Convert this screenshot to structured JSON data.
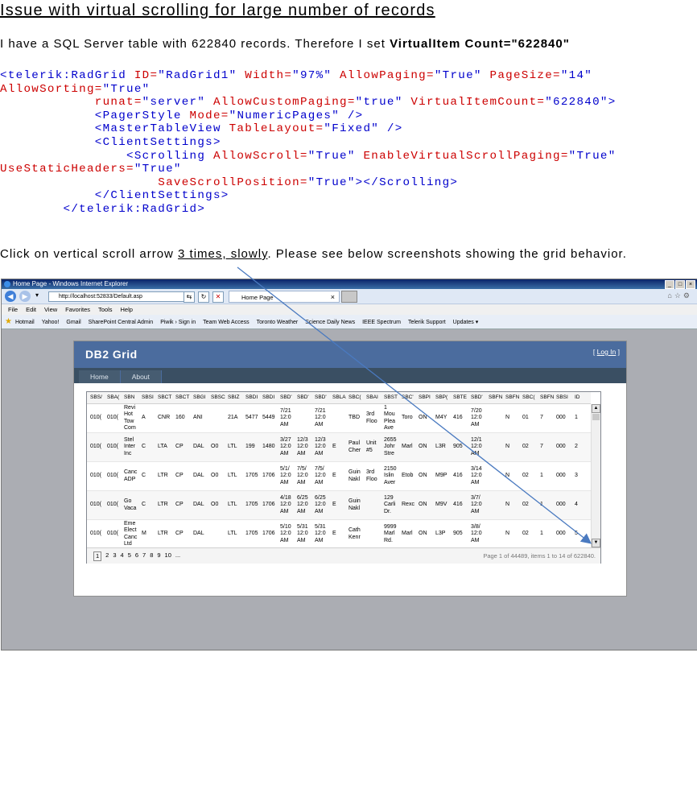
{
  "title": "Issue with virtual scrolling for large number of records",
  "intro": {
    "prefix": "I have a SQL Server table with 622840 records. Therefore I set ",
    "bold": "VirtualItem Count=\"622840\""
  },
  "code_lines": [
    [
      [
        "tag",
        "<telerik:RadGrid "
      ],
      [
        "attr",
        "ID="
      ],
      [
        "val",
        "\"RadGrid1\" "
      ],
      [
        "attr",
        "Width="
      ],
      [
        "val",
        "\"97%\" "
      ],
      [
        "attr",
        "AllowPaging="
      ],
      [
        "val",
        "\"True\" "
      ],
      [
        "attr",
        "PageSize="
      ],
      [
        "val",
        "\"14\""
      ]
    ],
    [
      [
        "attr",
        "AllowSorting="
      ],
      [
        "val",
        "\"True\""
      ]
    ],
    [
      [
        "tag",
        "            "
      ],
      [
        "attr",
        "runat="
      ],
      [
        "val",
        "\"server\" "
      ],
      [
        "attr",
        "AllowCustomPaging="
      ],
      [
        "val",
        "\"true\" "
      ],
      [
        "attr",
        "VirtualItemCount="
      ],
      [
        "val",
        "\"622840\">"
      ]
    ],
    [
      [
        "tag",
        "            <PagerStyle "
      ],
      [
        "attr",
        "Mode="
      ],
      [
        "val",
        "\"NumericPages\" />"
      ]
    ],
    [
      [
        "tag",
        "            <MasterTableView "
      ],
      [
        "attr",
        "TableLayout="
      ],
      [
        "val",
        "\"Fixed\" />"
      ]
    ],
    [
      [
        "tag",
        "            <ClientSettings>"
      ]
    ],
    [
      [
        "tag",
        "                <Scrolling "
      ],
      [
        "attr",
        "AllowScroll="
      ],
      [
        "val",
        "\"True\" "
      ],
      [
        "attr",
        "EnableVirtualScrollPaging="
      ],
      [
        "val",
        "\"True\""
      ]
    ],
    [
      [
        "attr",
        "UseStaticHeaders="
      ],
      [
        "val",
        "\"True\""
      ]
    ],
    [
      [
        "tag",
        "                    "
      ],
      [
        "attr",
        "SaveScrollPosition="
      ],
      [
        "val",
        "\"True\"></Scrolling>"
      ]
    ],
    [
      [
        "tag",
        "            </ClientSettings>"
      ]
    ],
    [
      [
        "tag",
        "        </telerik:RadGrid>"
      ]
    ]
  ],
  "instruction": {
    "prefix": "Click on vertical scroll arrow ",
    "underlined": "3 times, slowly",
    "suffix": ". Please see below screenshots showing the grid behavior."
  },
  "screenshot": {
    "window_title": "Home Page - Windows Internet Explorer",
    "address": "http://localhost:52833/Default.asp",
    "tab_title": "Home Page",
    "menu": [
      "File",
      "Edit",
      "View",
      "Favorites",
      "Tools",
      "Help"
    ],
    "favorites": [
      "Hotmail",
      "Yahoo!",
      "Gmail",
      "SharePoint Central Admin",
      "Piwik › Sign in",
      "Team Web Access",
      "Toronto Weather",
      "Science Daily News",
      "IEEE Spectrum",
      "Telerik Support",
      "Updates ▾"
    ],
    "app_title": "DB2 Grid",
    "login": "Log In",
    "nav": [
      "Home",
      "About"
    ],
    "grid_headers": [
      "SBS/",
      "SBA(",
      "SBN",
      "SBSI",
      "SBCT",
      "SBCT",
      "SBGI",
      "SBSC",
      "SBIZ",
      "SBDI",
      "SBDI",
      "SBD'",
      "SBD'",
      "SBD'",
      "SBLA",
      "SBC(",
      "SBAI",
      "SBST",
      "SBC'",
      "SBPI",
      "SBP(",
      "SBTE",
      "SBD'",
      "SBFN",
      "SBFN",
      "SBC(",
      "SBFN",
      "SBSI",
      "ID"
    ],
    "grid_rows": [
      [
        "010(",
        "010(",
        "Revi\nHot\nTow\nCom",
        "A",
        "CNR",
        "160",
        "ANI",
        "",
        "21A",
        "5477",
        "5449",
        "7/21\n12:0\nAM",
        "",
        "7/21\n12:0\nAM",
        "",
        "TBD",
        "3rd\nFloo",
        "1\nMou\nPlea\nAve",
        "Toro",
        "ON",
        "M4Y",
        "416",
        "7/20\n12:0\nAM",
        "",
        "N",
        "01",
        "7",
        "000",
        "1"
      ],
      [
        "010(",
        "010(",
        "Stel\nInter\nInc",
        "C",
        "LTA",
        "CP",
        "DAL",
        "O0",
        "LTL",
        "199",
        "1480",
        "3/27\n12:0\nAM",
        "12/3\n12:0\nAM",
        "12/3\n12:0\nAM",
        "E",
        "Paul\nCher",
        "Unit\n#5",
        "2655\nJohr\nStre",
        "Marl",
        "ON",
        "L3R",
        "905",
        "12/1\n12:0\nAM",
        "",
        "N",
        "02",
        "7",
        "000",
        "2"
      ],
      [
        "010(",
        "010(",
        "Canc\nADP",
        "C",
        "LTR",
        "CP",
        "DAL",
        "O0",
        "LTL",
        "1705",
        "1706",
        "5/1/\n12:0\nAM",
        "7/5/\n12:0\nAM",
        "7/5/\n12:0\nAM",
        "E",
        "Guin\nNakl",
        "3rd\nFloo",
        "2150\nIslin\nAver",
        "Etob",
        "ON",
        "M9P",
        "416",
        "3/14\n12:0\nAM",
        "",
        "N",
        "02",
        "1",
        "000",
        "3"
      ],
      [
        "010(",
        "010(",
        "Go\nVaca",
        "C",
        "LTR",
        "CP",
        "DAL",
        "O0",
        "LTL",
        "1705",
        "1706",
        "4/18\n12:0\nAM",
        "6/25\n12:0\nAM",
        "6/25\n12:0\nAM",
        "E",
        "Guin\nNakl",
        "",
        "129\nCarli\nDr.",
        "Rexc",
        "ON",
        "M9V",
        "416",
        "3/7/\n12:0\nAM",
        "",
        "N",
        "02",
        "1",
        "000",
        "4"
      ],
      [
        "010(",
        "010(",
        "Eme\nElect\nCanc\nLtd",
        "M",
        "LTR",
        "CP",
        "DAL",
        "",
        "LTL",
        "1705",
        "1706",
        "5/10\n12:0\nAM",
        "5/31\n12:0\nAM",
        "5/31\n12:0\nAM",
        "E",
        "Cath\nKenr",
        "",
        "9999\nMarl\nRd.",
        "Marl",
        "ON",
        "L3P",
        "905",
        "3/8/\n12:0\nAM",
        "",
        "N",
        "02",
        "1",
        "000",
        "5"
      ]
    ],
    "pages": [
      "1",
      "2",
      "3",
      "4",
      "5",
      "6",
      "7",
      "8",
      "9",
      "10",
      "..."
    ],
    "pager_info": "Page 1 of 44489, items 1 to 14 of 622840."
  },
  "colors": {
    "code_tag": "#0000cc",
    "code_attr": "#cc0000",
    "arrow": "#4a7ac0",
    "app_header": "#4b6c9e",
    "app_nav": "#3a4f63"
  }
}
